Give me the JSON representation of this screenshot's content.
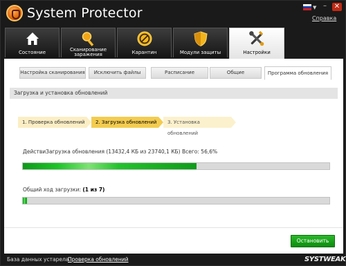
{
  "app": {
    "title": "System Protector",
    "help_label": "Справка",
    "minimize": "–",
    "close": "✕",
    "flag_arrow": "▼"
  },
  "tabs": [
    {
      "label": "Состояние",
      "icon": "home-icon"
    },
    {
      "label": "Сканирование заражения",
      "icon": "magnifier-icon"
    },
    {
      "label": "Карантин",
      "icon": "quarantine-icon"
    },
    {
      "label": "Модули защиты",
      "icon": "shield-icon"
    },
    {
      "label": "Настройки",
      "icon": "tools-icon",
      "active": true
    }
  ],
  "subtabs": [
    "Настройка сканирования",
    "Исключить файлы",
    "Расписание",
    "Общие",
    "Программа обновления"
  ],
  "section_title": "Загрузка и установка обновлений",
  "steps": [
    "1. Проверка обновлений",
    "2. Загрузка обновлений",
    "3. Установка обновлений"
  ],
  "download": {
    "action_text": "ДействиЗагрузка обновления (13432,4 КБ из 23740,1 КБ) Всего: 56,6%",
    "progress_fraction": 0.566
  },
  "overall": {
    "label": "Общий ход загрузки:",
    "count": "(1 из 7)",
    "progress_fraction": 0.0143
  },
  "stop_button": "Остановить",
  "status": {
    "text": "База данных устарела.",
    "link": "Проверка обновлений"
  },
  "brand": {
    "part1": "SYS",
    "part2": "TWEAK"
  },
  "colors": {
    "accent_green": "#1cc428",
    "current_step": "#f3cc4f",
    "close_red": "#c02a14"
  }
}
